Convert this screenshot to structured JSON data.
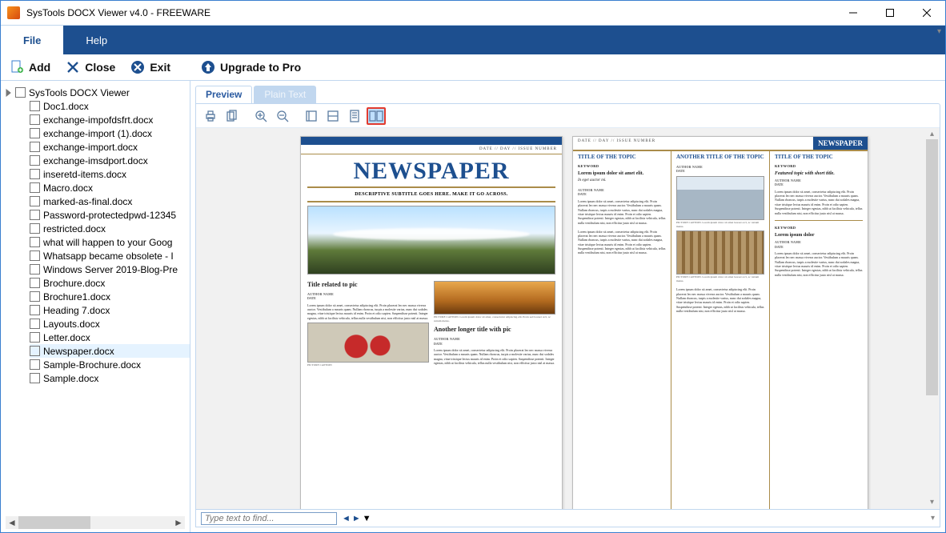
{
  "window": {
    "title": "SysTools DOCX Viewer v4.0 - FREEWARE"
  },
  "menu": {
    "file": "File",
    "help": "Help"
  },
  "toolbar": {
    "add": "Add",
    "close": "Close",
    "exit": "Exit",
    "upgrade": "Upgrade to Pro"
  },
  "tree": {
    "root": "SysTools DOCX Viewer",
    "items": [
      "Doc1.docx",
      "exchange-impofdsfrt.docx",
      "exchange-import (1).docx",
      "exchange-import.docx",
      "exchange-imsdport.docx",
      "inseretd-items.docx",
      "Macro.docx",
      "marked-as-final.docx",
      "Password-protectedpwd-12345",
      "restricted.docx",
      "what will happen to your Goog",
      "Whatsapp became obsolete - I",
      "Windows Server 2019-Blog-Pre",
      "Brochure.docx",
      "Brochure1.docx",
      "Heading 7.docx",
      "Layouts.docx",
      "Letter.docx",
      "Newspaper.docx",
      "Sample-Brochure.docx",
      "Sample.docx"
    ],
    "selected_index": 18
  },
  "subtabs": {
    "preview": "Preview",
    "plaintext": "Plain Text"
  },
  "search": {
    "placeholder": "Type text to find..."
  },
  "doc": {
    "page1": {
      "dateline": "DATE  //  DAY  //  ISSUE NUMBER",
      "masthead": "NEWSPAPER",
      "subtitle": "DESCRIPTIVE SUBTITLE GOES HERE.  MAKE IT GO ACROSS.",
      "col_left": {
        "title": "Title related to pic",
        "author": "AUTHOR NAME",
        "date": "DATE",
        "picture_caption": "PICTURE CAPTION"
      },
      "col_right": {
        "caption1": "PICTURE CAPTION. Lorem ipsum dolor sit amet, consectetur adipiscing elit. Proin sed laoreet orci, ac rutrum metus.",
        "title": "Another longer title with pic",
        "author": "AUTHOR NAME",
        "date": "DATE"
      }
    },
    "page2": {
      "dateline": "DATE  //  DAY  //  ISSUE NUMBER",
      "masthead": "NEWSPAPER",
      "col1": {
        "title": "TITLE OF THE TOPIC",
        "kw": "KEYWORD",
        "lead": "Lorem ipsum dolor sit amet elit.",
        "sub": "In eget auctor mi.",
        "author": "AUTHOR NAME",
        "date": "DATE"
      },
      "col2": {
        "title": "ANOTHER TITLE OF THE TOPIC",
        "author": "AUTHOR NAME",
        "date": "DATE",
        "caption": "PICTURE CAPTION. Lorem ipsum dolor sit amet laoreet orci, ac rutrum metus."
      },
      "col3": {
        "title": "TITLE OF THE TOPIC",
        "kw": "KEYWORD",
        "lead": "Featured topic with short title.",
        "author": "AUTHOR NAME",
        "date": "DATE",
        "kw2": "KEYWORD",
        "lead2": "Lorem ipsum dolor",
        "author2": "AUTHOR NAME",
        "date2": "DATE"
      }
    },
    "lorem": "Lorem ipsum dolor sit amet, consectetur adipiscing elit. Proin placerat leo nec massa viverra auctor. Vestibulum a mauris quam. Nullam rhoncus, turpis a molestie varius, nunc dui sodales magna, vitae tristique lectus mauris id enim. Proin et odio sapien. Suspendisse potenti. Integer egestas, nibh ut facilisis vehicula, tellus nulla vestibulum nisi, non efficitur justo nisl at massa."
  }
}
